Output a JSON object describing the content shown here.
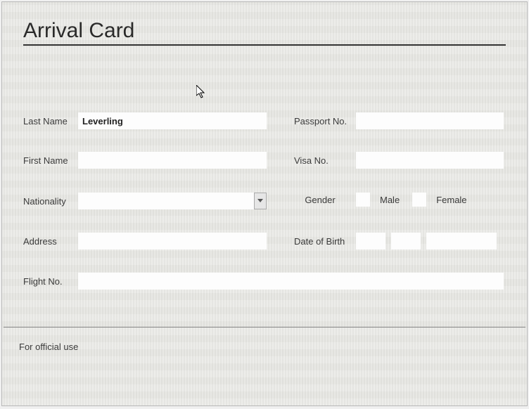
{
  "form": {
    "title": "Arrival Card",
    "last_name_label": "Last Name",
    "last_name_value": "Leverling",
    "first_name_label": "First Name",
    "first_name_value": "",
    "nationality_label": "Nationality",
    "nationality_value": "",
    "address_label": "Address",
    "address_value": "",
    "flight_no_label": "Flight No.",
    "flight_no_value": "",
    "passport_no_label": "Passport No.",
    "passport_no_value": "",
    "visa_no_label": "Visa No.",
    "visa_no_value": "",
    "gender_label": "Gender",
    "male_label": "Male",
    "female_label": "Female",
    "dob_label": "Date of Birth",
    "dob_day": "",
    "dob_month": "",
    "dob_year": "",
    "official_use_label": "For official use"
  }
}
